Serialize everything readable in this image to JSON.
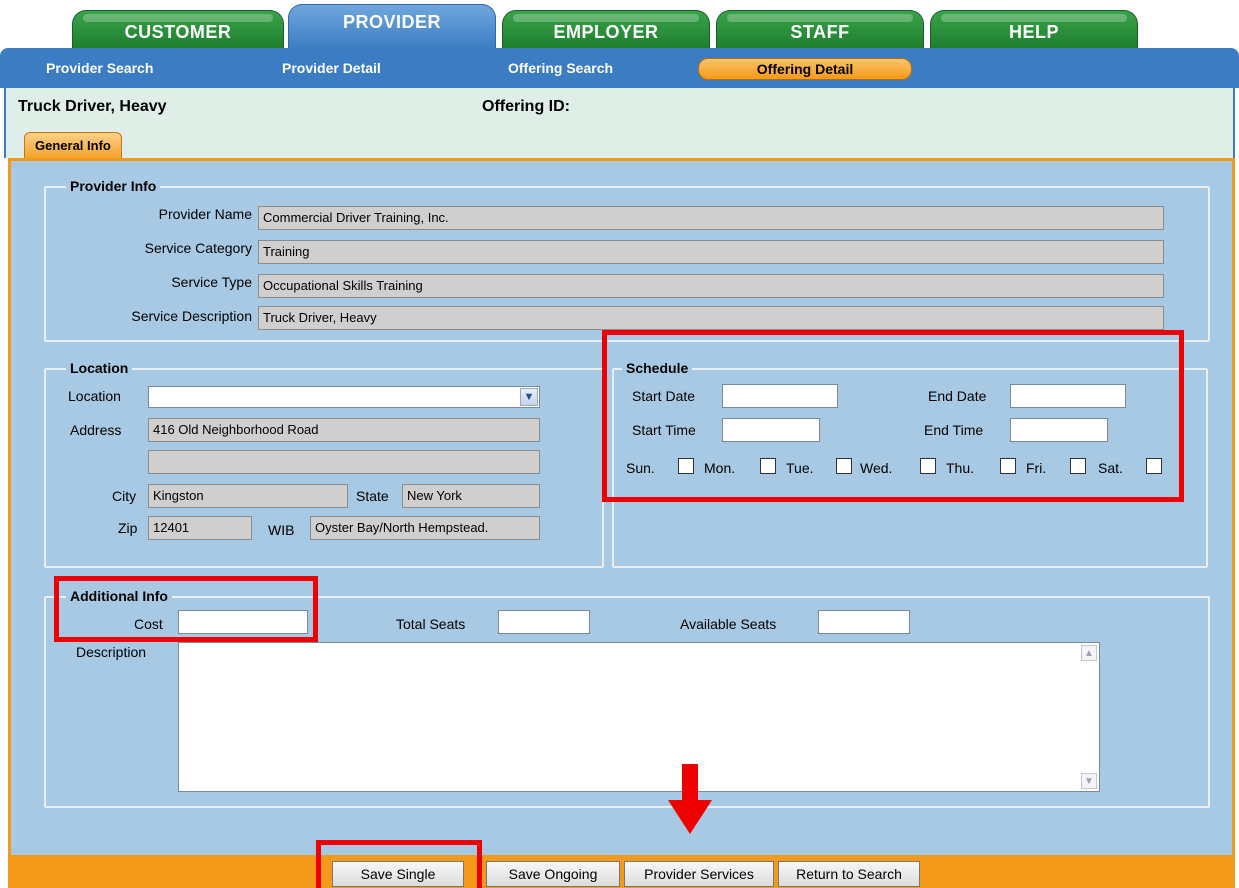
{
  "top_tabs": [
    {
      "label": "CUSTOMER"
    },
    {
      "label": "PROVIDER"
    },
    {
      "label": "EMPLOYER"
    },
    {
      "label": "STAFF"
    },
    {
      "label": "HELP"
    }
  ],
  "subnav": [
    {
      "label": "Provider Search"
    },
    {
      "label": "Provider Detail"
    },
    {
      "label": "Offering Search"
    },
    {
      "label": "Offering Detail"
    }
  ],
  "header": {
    "title": "Truck Driver, Heavy",
    "offering_label": "Offering ID:",
    "tab": "General Info"
  },
  "provider_info": {
    "legend": "Provider Info",
    "provider_name_label": "Provider Name",
    "provider_name": "Commercial Driver Training, Inc.",
    "service_category_label": "Service Category",
    "service_category": "Training",
    "service_type_label": "Service Type",
    "service_type": "Occupational Skills Training",
    "service_description_label": "Service Description",
    "service_description": "Truck Driver, Heavy"
  },
  "location": {
    "legend": "Location",
    "location_label": "Location",
    "location_value": "",
    "address_label": "Address",
    "address1": "416 Old Neighborhood Road",
    "address2": "",
    "city_label": "City",
    "city": "Kingston",
    "state_label": "State",
    "state": "New York",
    "zip_label": "Zip",
    "zip": "12401",
    "wib_label": "WIB",
    "wib": "Oyster Bay/North Hempstead."
  },
  "schedule": {
    "legend": "Schedule",
    "start_date_label": "Start Date",
    "end_date_label": "End Date",
    "start_time_label": "Start Time",
    "end_time_label": "End Time",
    "days": [
      "Sun.",
      "Mon.",
      "Tue.",
      "Wed.",
      "Thu.",
      "Fri.",
      "Sat."
    ]
  },
  "additional_info": {
    "legend": "Additional Info",
    "cost_label": "Cost",
    "total_seats_label": "Total Seats",
    "available_seats_label": "Available Seats",
    "description_label": "Description"
  },
  "buttons": {
    "save_single": "Save Single",
    "save_ongoing": "Save Ongoing",
    "provider_services": "Provider Services",
    "return_to_search": "Return to Search"
  },
  "colors": {
    "tab_green": "#1e7f2f",
    "tab_blue": "#3b7cc2",
    "accent_orange": "#f39a1a",
    "panel_blue": "#a7c9e3",
    "annotation_red": "#ee0000"
  }
}
